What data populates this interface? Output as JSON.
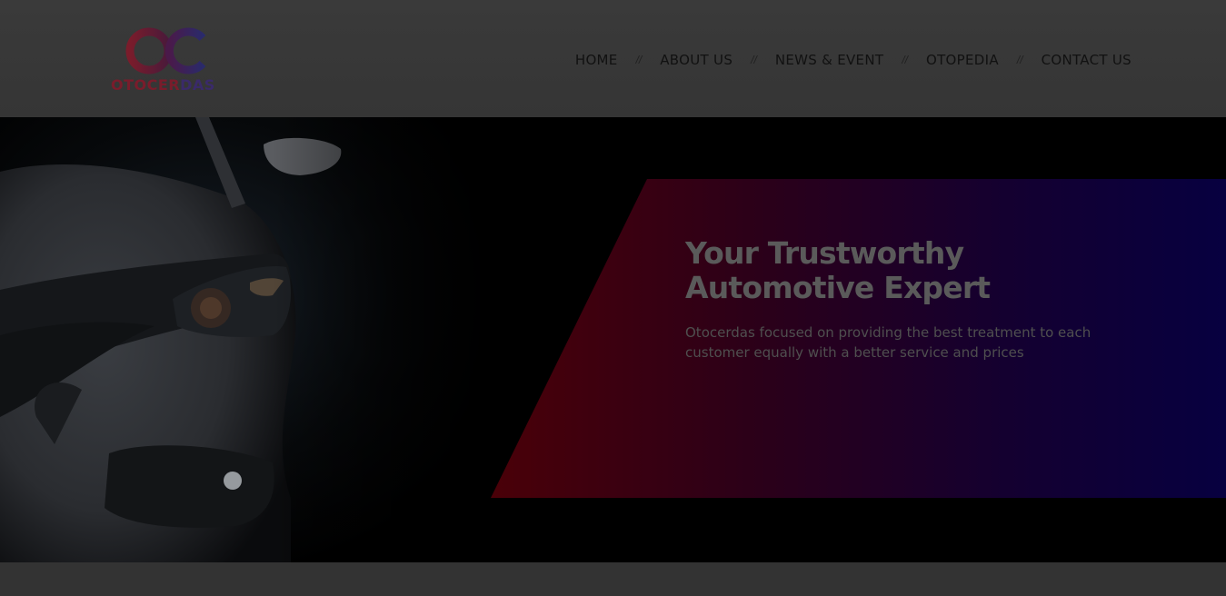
{
  "logo": {
    "mark_icon": "oc-rings-logo",
    "text_part1": "OTOCER",
    "text_part2": "DAS",
    "colors": {
      "red": "#7a1c2b",
      "purple": "#3a2a6a"
    }
  },
  "nav": {
    "items": [
      {
        "label": "HOME"
      },
      {
        "label": "ABOUT US"
      },
      {
        "label": "NEWS & EVENT"
      },
      {
        "label": "OTOPEDIA"
      },
      {
        "label": "CONTACT US"
      }
    ],
    "separator": "//"
  },
  "hero": {
    "title": "Your Trustworthy Automotive Expert",
    "subtitle": "Otocerdas focused on providing the best treatment to each customer equally with a better service and prices",
    "image_icon": "car-headlight-image",
    "panel_gradient": [
      "#4a0008",
      "#070040"
    ]
  }
}
